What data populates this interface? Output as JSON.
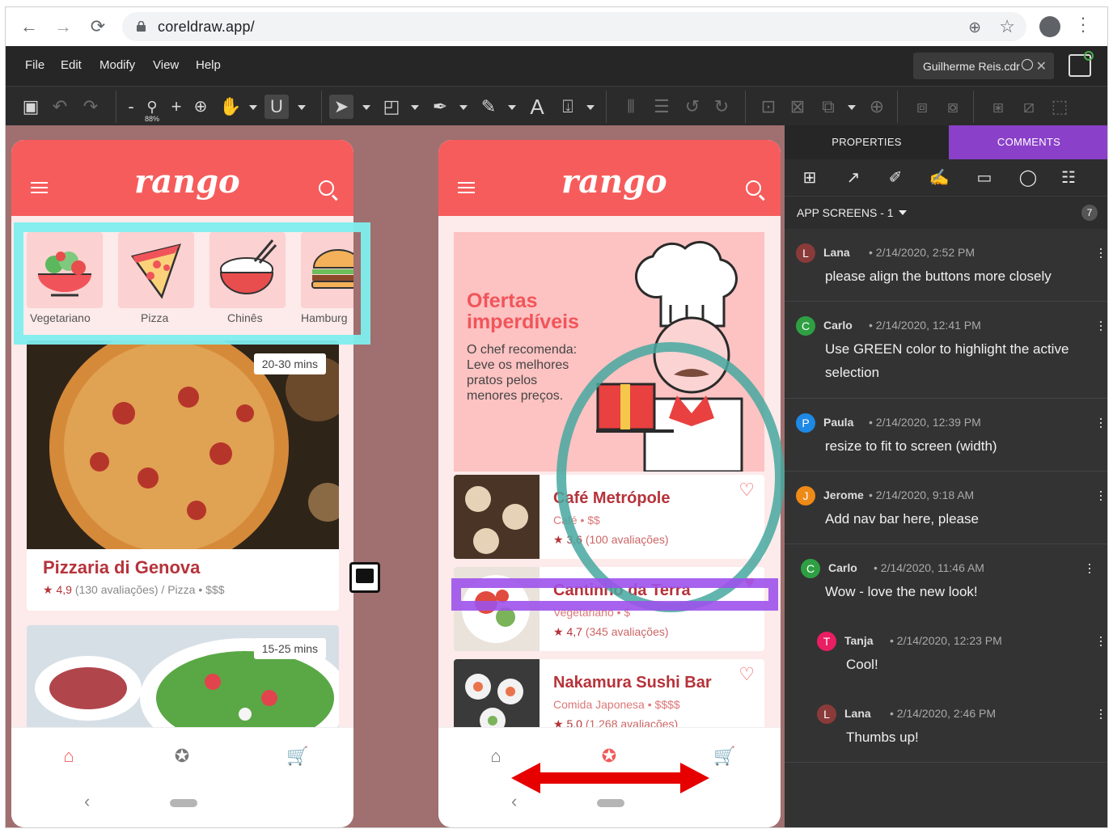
{
  "browser": {
    "url": "coreldraw.app/"
  },
  "menubar": {
    "items": [
      "File",
      "Edit",
      "Modify",
      "View",
      "Help"
    ],
    "doc_tab": "Guilherme Reis.cdr"
  },
  "toolbar": {
    "zoom_level": "88%"
  },
  "app_screens": {
    "logo": "rango",
    "categories": [
      "Vegetariano",
      "Pizza",
      "Chinês",
      "Hamburg"
    ],
    "featured": {
      "time": "20-30 mins",
      "name": "Pizzaria di Genova",
      "rating": "4,9",
      "reviews": "(130 avaliações)",
      "meta": " / Pizza • $$$"
    },
    "second_card_time": "15-25 mins",
    "banner": {
      "title_l1": "Ofertas",
      "title_l2": "imperdíveis",
      "l1": "O chef recomenda:",
      "l2": "Leve os melhores",
      "l3": "pratos pelos",
      "l4": "menores preços."
    },
    "restaurants": [
      {
        "name": "Café Metrópole",
        "sub": "Café • $$",
        "rating": "3,6",
        "reviews": "(100 avaliações)"
      },
      {
        "name": "Cantinho da Terra",
        "sub": "Vegetariano • $",
        "rating": "4,7",
        "reviews": "(345 avaliações)"
      },
      {
        "name": "Nakamura Sushi Bar",
        "sub": "Comida Japonesa • $$$$",
        "rating": "5,0",
        "reviews": "(1.268 avaliações)"
      }
    ]
  },
  "panel": {
    "tab_properties": "PROPERTIES",
    "tab_comments": "COMMENTS",
    "page_select": "APP SCREENS - 1",
    "comment_count": "7",
    "comments": [
      {
        "initial": "L",
        "color": "#8b3a3a",
        "author": "Lana",
        "time": "2/14/2020, 2:52 PM",
        "text": "please align the buttons more closely"
      },
      {
        "initial": "C",
        "color": "#2ea043",
        "author": "Carlo",
        "time": "2/14/2020, 12:41 PM",
        "text": "Use GREEN color to highlight the active selection"
      },
      {
        "initial": "P",
        "color": "#1e88e5",
        "author": "Paula",
        "time": "2/14/2020, 12:39 PM",
        "text": "resize to fit to screen (width)"
      },
      {
        "initial": "J",
        "color": "#ef8a17",
        "author": "Jerome",
        "time": "2/14/2020, 9:18 AM",
        "text": "Add nav bar here, please"
      },
      {
        "initial": "C",
        "color": "#2ea043",
        "author": "Carlo",
        "time": "2/14/2020, 11:46 AM",
        "text": "Wow - love the new look!"
      },
      {
        "initial": "T",
        "color": "#e91e63",
        "author": "Tanja",
        "time": "2/14/2020, 12:23 PM",
        "text": "Cool!"
      },
      {
        "initial": "L",
        "color": "#8b3a3a",
        "author": "Lana",
        "time": "2/14/2020, 2:46 PM",
        "text": "Thumbs up!"
      }
    ]
  }
}
